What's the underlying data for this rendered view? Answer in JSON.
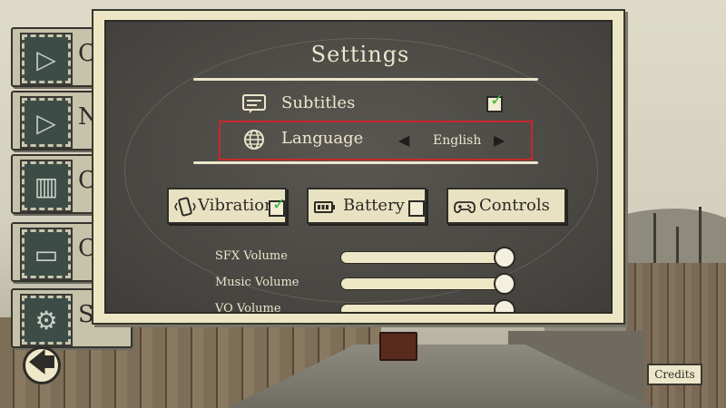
{
  "menu": {
    "items": [
      {
        "label": "C",
        "icon": "play-icon"
      },
      {
        "label": "N",
        "icon": "play-icon"
      },
      {
        "label": "C",
        "icon": "books-icon"
      },
      {
        "label": "C",
        "icon": "folder-icon"
      },
      {
        "label": "S",
        "icon": "gear-icon"
      }
    ]
  },
  "settings": {
    "title": "Settings",
    "subtitles": {
      "label": "Subtitles",
      "checked": true
    },
    "language": {
      "label": "Language",
      "value": "English"
    },
    "options": {
      "vibrations": {
        "label": "Vibrations",
        "checked": true
      },
      "battery": {
        "label": "Battery",
        "checked": false
      },
      "controls": {
        "label": "Controls"
      }
    },
    "volumes": [
      {
        "label": "SFX Volume",
        "level": 1.0
      },
      {
        "label": "Music Volume",
        "level": 1.0
      },
      {
        "label": "VO Volume",
        "level": 1.0
      }
    ]
  },
  "footer": {
    "back_icon": "arrow-left-icon",
    "credits_label": "Credits"
  },
  "colors": {
    "panel_frame": "#ece6c4",
    "panel_bg": "#4c4a45",
    "highlight": "#c9262c",
    "check": "#36b53a"
  }
}
